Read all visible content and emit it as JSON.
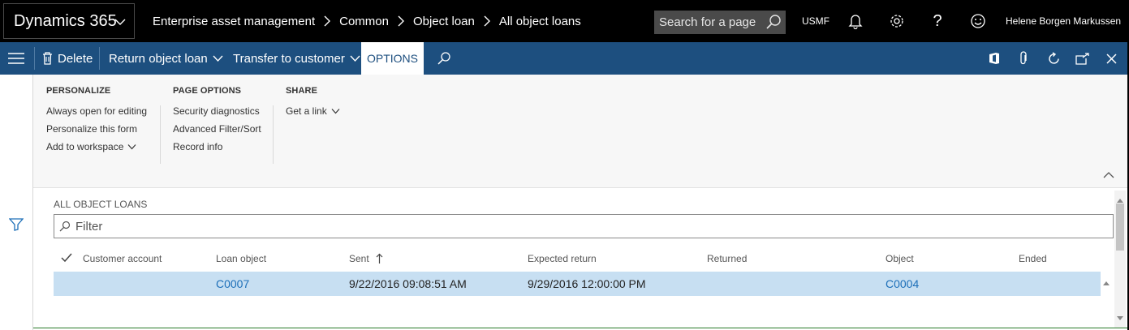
{
  "topbar": {
    "app_title": "Dynamics 365",
    "breadcrumbs": [
      "Enterprise asset management",
      "Common",
      "Object loan",
      "All object loans"
    ],
    "search_placeholder": "Search for a page",
    "company": "USMF",
    "user_name": "Helene Borgen Markussen",
    "icons": [
      "chevron-down-icon",
      "search-icon",
      "bell-icon",
      "gear-icon",
      "help-icon",
      "smiley-icon"
    ]
  },
  "actionbar": {
    "delete_label": "Delete",
    "return_label": "Return object loan",
    "transfer_label": "Transfer to customer",
    "options_label": "OPTIONS",
    "icons": [
      "hamburger-icon",
      "trash-icon",
      "search-icon",
      "office-icon",
      "attachment-icon",
      "refresh-icon",
      "popout-icon",
      "close-icon"
    ]
  },
  "ribbon": {
    "groups": [
      {
        "title": "PERSONALIZE",
        "items": [
          "Always open for editing",
          "Personalize this form",
          "Add to workspace"
        ]
      },
      {
        "title": "PAGE OPTIONS",
        "items": [
          "Security diagnostics",
          "Advanced Filter/Sort",
          "Record info"
        ]
      },
      {
        "title": "SHARE",
        "items": [
          "Get a link"
        ]
      }
    ]
  },
  "grid": {
    "title": "ALL OBJECT LOANS",
    "filter_placeholder": "Filter",
    "columns": [
      "Customer account",
      "Loan object",
      "Sent",
      "Expected return",
      "Returned",
      "Object",
      "Ended"
    ],
    "sort_column": "Sent",
    "rows": [
      {
        "customer_account": "",
        "loan_object": "C0007",
        "sent": "9/22/2016 09:08:51 AM",
        "expected_return": "9/29/2016 12:00:00 PM",
        "returned": "",
        "object": "C0004",
        "ended": ""
      }
    ]
  },
  "colors": {
    "topbar_bg": "#000000",
    "actionbar_bg": "#1d4f7f",
    "ribbon_bg": "#f7f7f7",
    "selected_row": "#c7dff2",
    "link": "#1d6fb8"
  }
}
